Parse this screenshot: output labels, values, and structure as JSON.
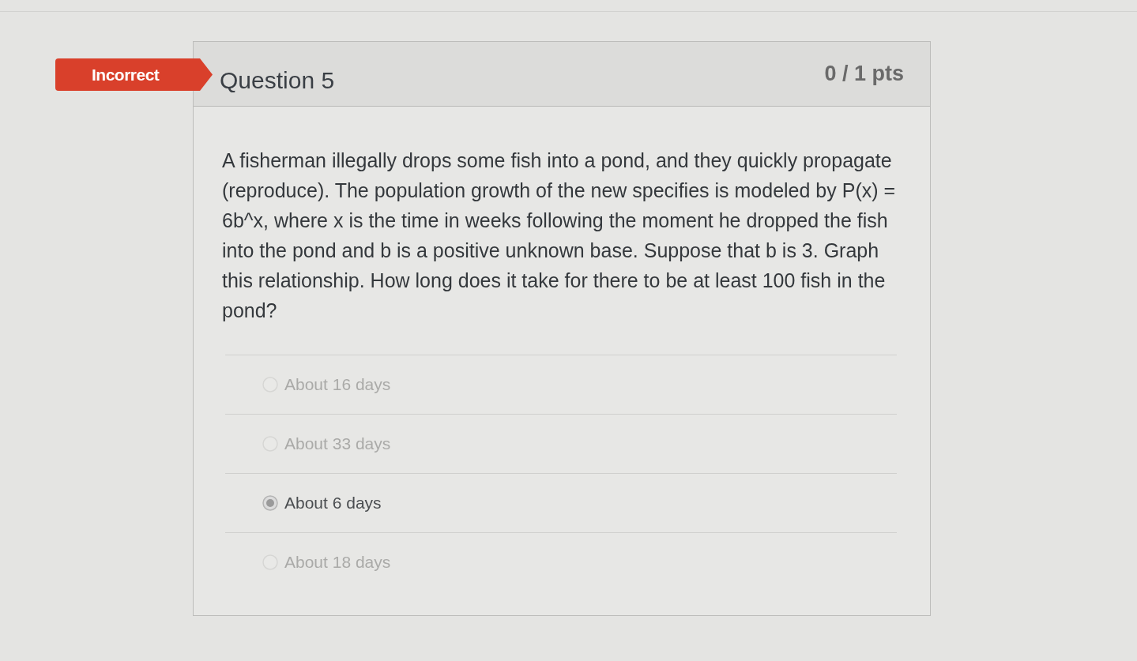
{
  "result_badge": "Incorrect",
  "question": {
    "title": "Question 5",
    "points": "0 / 1 pts",
    "text": "A fisherman illegally drops some fish into a pond, and they quickly propagate (reproduce). The population growth of the new specifies is modeled by P(x) = 6b^x, where x is the time in weeks following the moment he dropped the fish into the pond and b is a positive unknown base. Suppose that b is 3. Graph this relationship. How long does it take for there to be at least 100 fish in the pond?",
    "answers": [
      {
        "label": "About 16 days",
        "selected": false
      },
      {
        "label": "About 33 days",
        "selected": false
      },
      {
        "label": "About 6 days",
        "selected": true
      },
      {
        "label": "About 18 days",
        "selected": false
      }
    ]
  }
}
